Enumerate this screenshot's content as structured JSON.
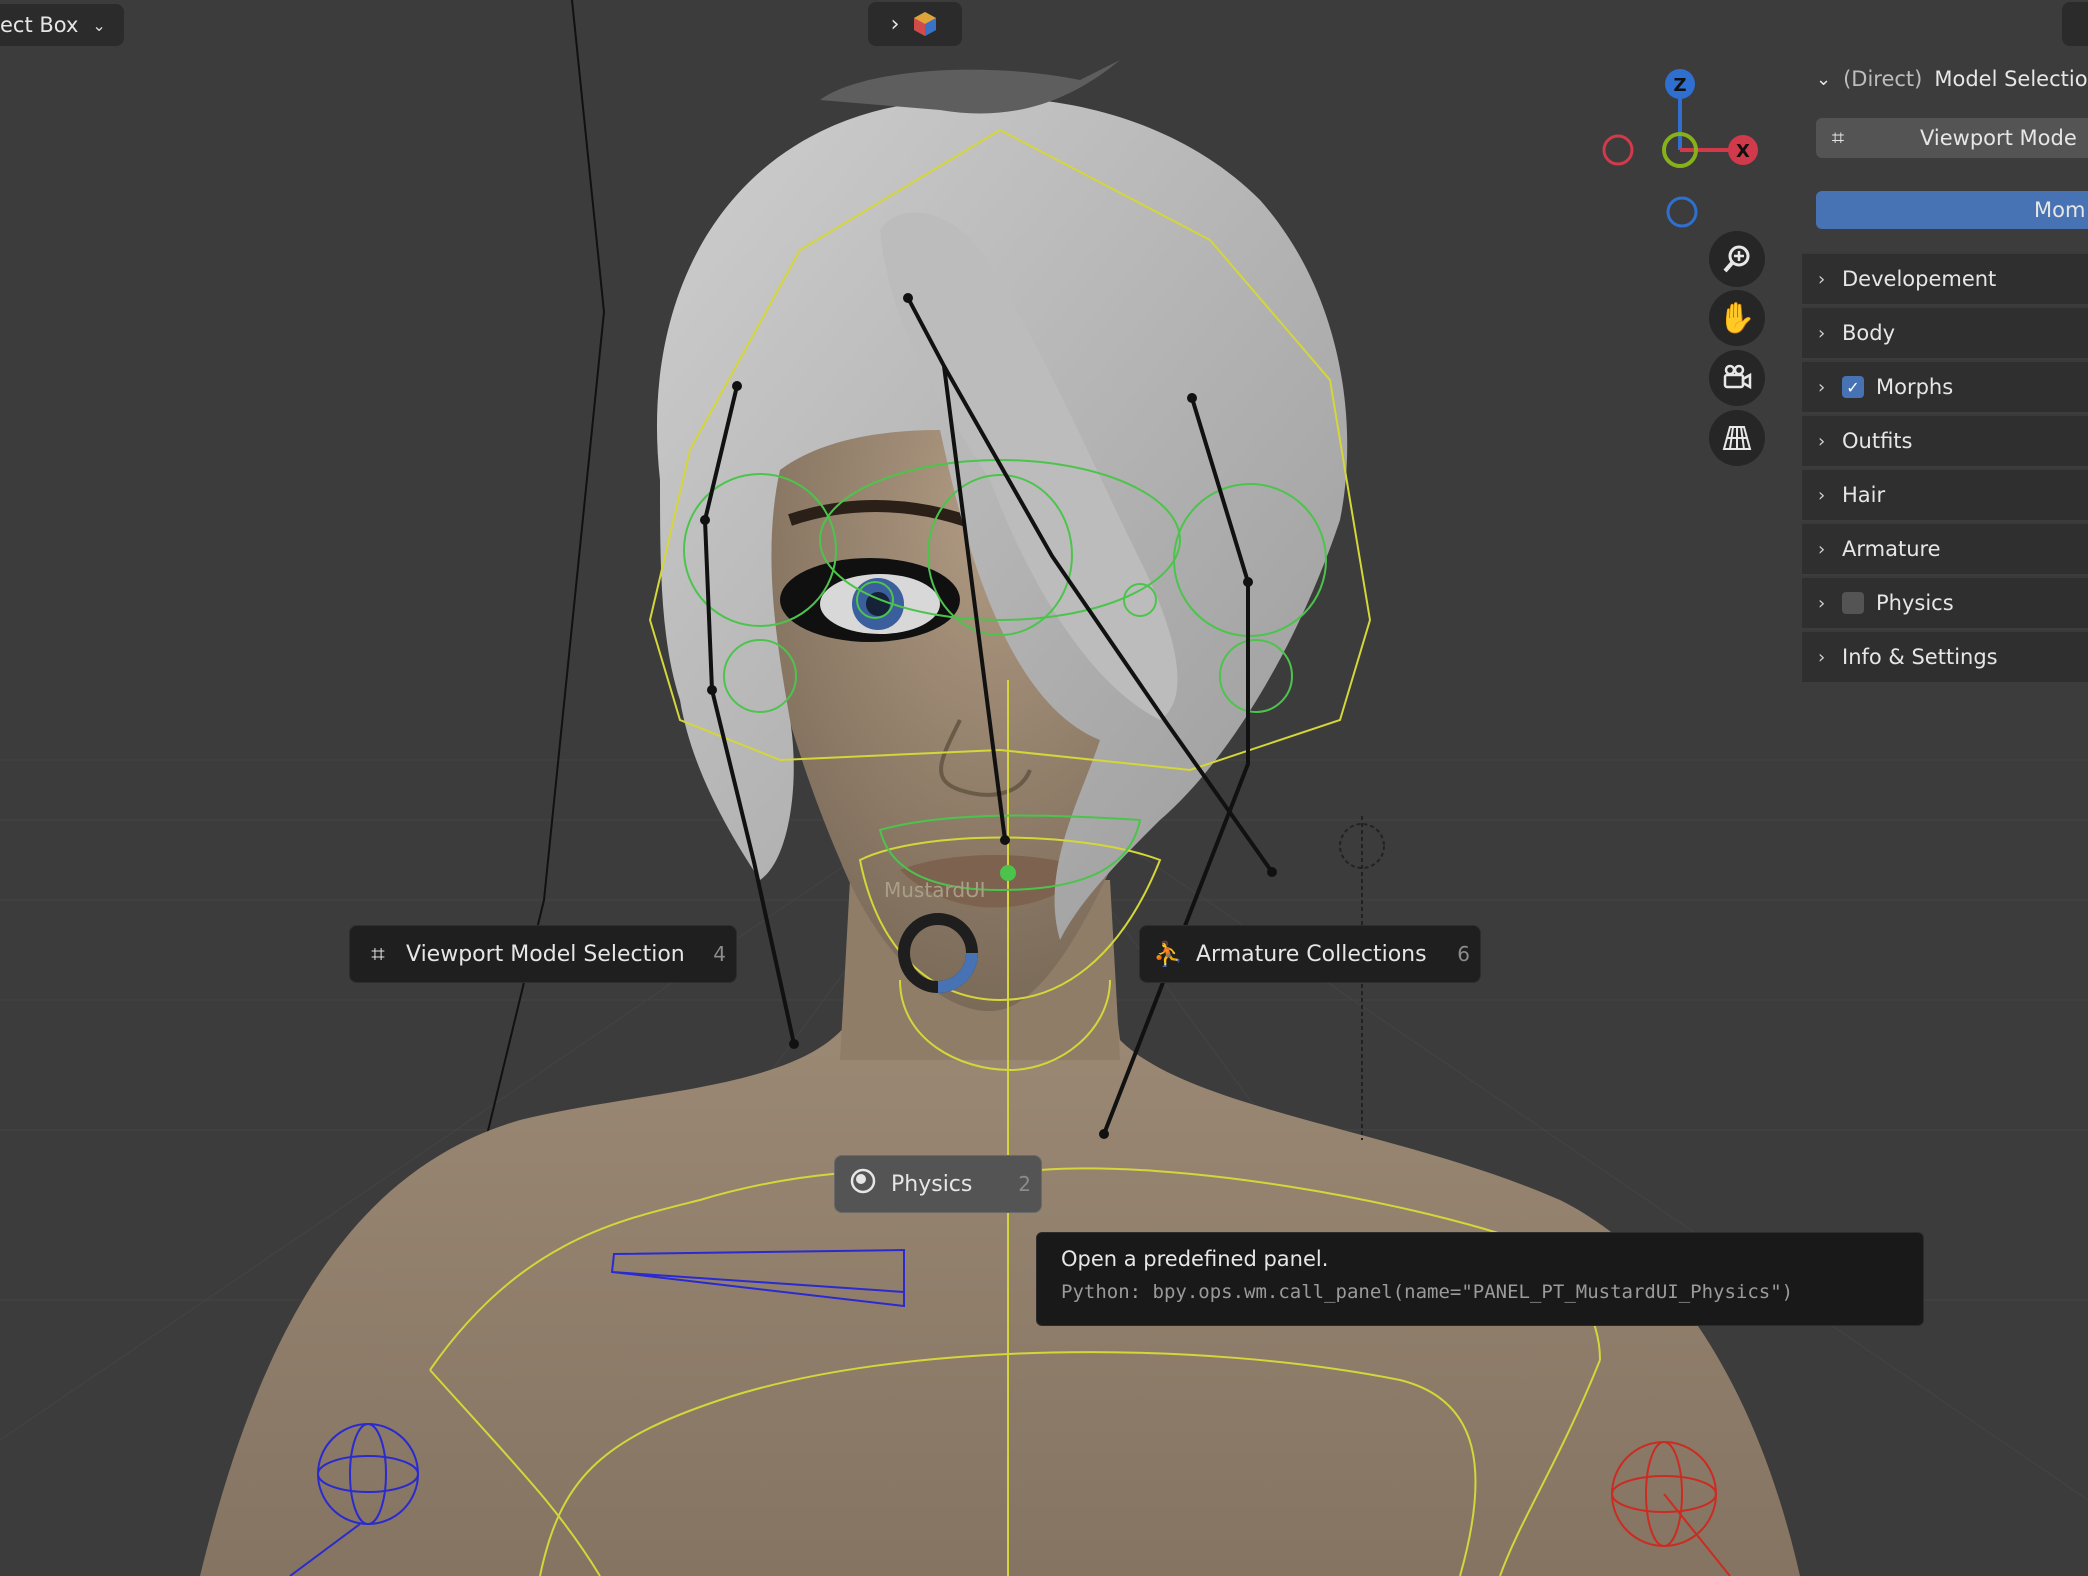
{
  "header": {
    "select_box_label": "ect Box",
    "select_box_icon": "chevron-down-icon",
    "overlay_icon": "chevron-right-icon"
  },
  "gizmo": {
    "z_label": "Z",
    "x_label": "X",
    "colors": {
      "z": "#2f6fd0",
      "x": "#d13a4a",
      "y": "#86b11a"
    }
  },
  "nav_icons": [
    "zoom-icon",
    "hand-pan-icon",
    "camera-icon",
    "perspective-grid-icon"
  ],
  "npanel": {
    "header_prefix": "(Direct)",
    "header_title": "Model Selection",
    "viewport_button": "Viewport Mode",
    "accent_button": "Mom",
    "items": [
      {
        "label": "Developement"
      },
      {
        "label": "Body"
      },
      {
        "label": "Morphs",
        "checkbox": true
      },
      {
        "label": "Outfits"
      },
      {
        "label": "Hair"
      },
      {
        "label": "Armature"
      },
      {
        "label": "Physics",
        "checkbox": false
      },
      {
        "label": "Info & Settings"
      }
    ]
  },
  "pie_menu": {
    "title": "MustardUI",
    "items": [
      {
        "label": "Viewport Model Selection",
        "shortcut": "4",
        "icon": "viewport-model-icon"
      },
      {
        "label": "Armature Collections",
        "shortcut": "6",
        "icon": "armature-icon"
      },
      {
        "label": "Physics",
        "shortcut": "2",
        "icon": "physics-icon"
      }
    ]
  },
  "tooltip": {
    "description": "Open a predefined panel.",
    "python": "Python: bpy.ops.wm.call_panel(name=\"PANEL_PT_MustardUI_Physics\")"
  }
}
